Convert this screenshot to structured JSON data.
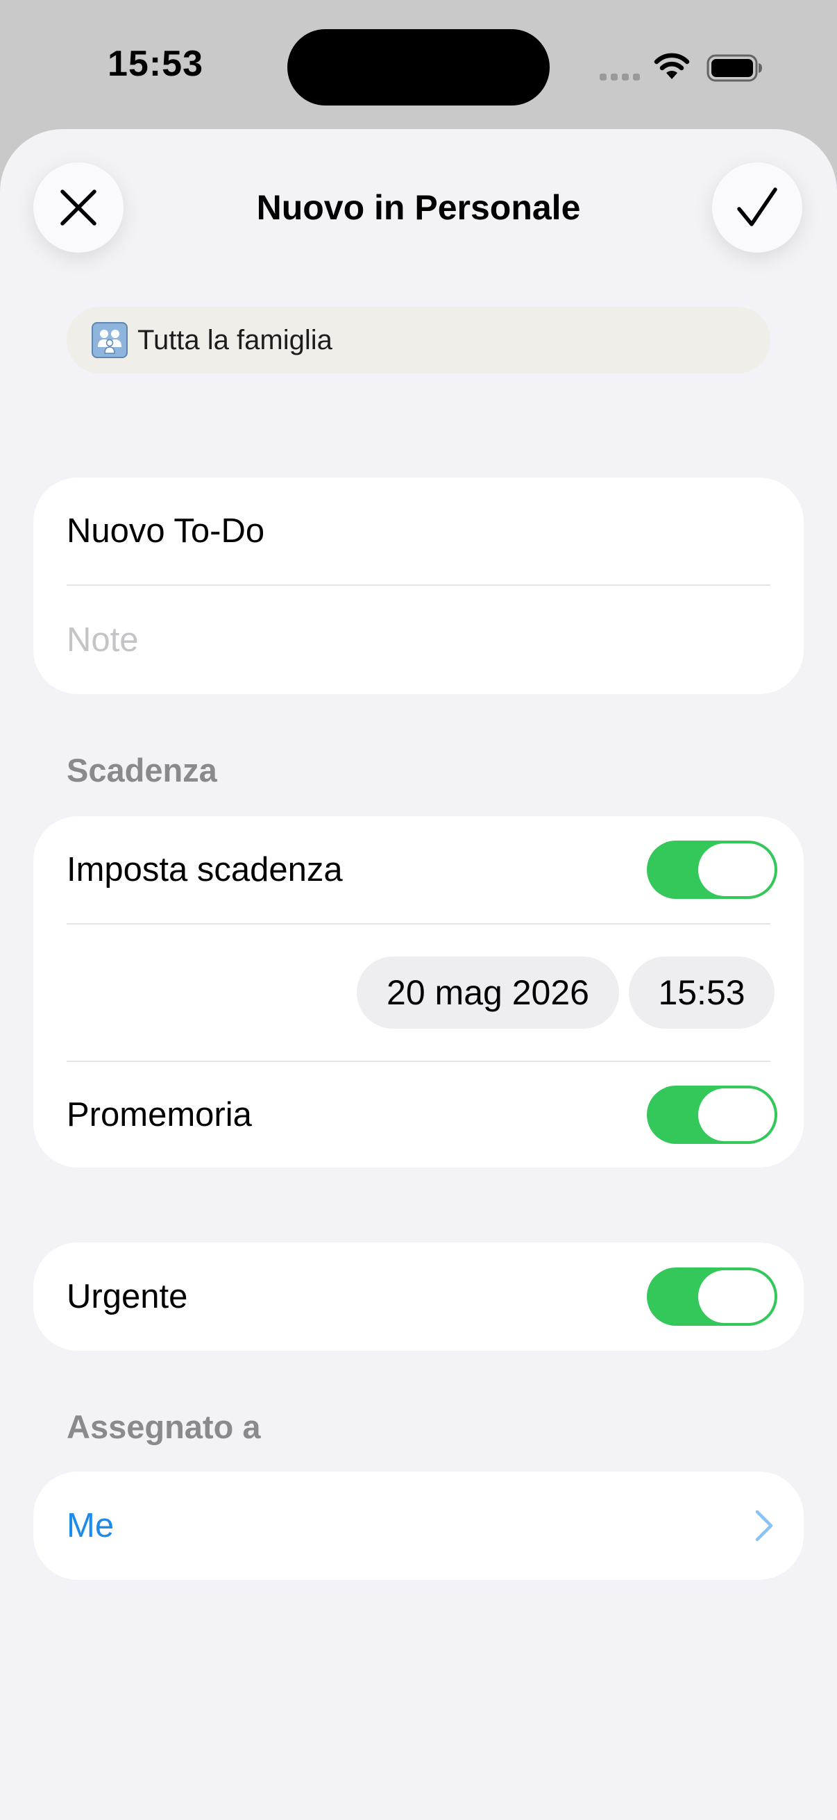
{
  "status_bar": {
    "time": "15:53",
    "wifi_icon": "wifi-icon",
    "battery_icon": "battery-icon"
  },
  "sheet": {
    "title": "Nuovo in Personale",
    "close_icon": "close-icon",
    "done_icon": "checkmark-icon"
  },
  "family_chip": {
    "icon": "family-icon",
    "label": "Tutta la famiglia"
  },
  "todo": {
    "title_value": "Nuovo To-Do",
    "notes_placeholder": "Note"
  },
  "deadline": {
    "header": "Scadenza",
    "set_deadline_label": "Imposta scadenza",
    "set_deadline_on": true,
    "date": "20 mag 2026",
    "time": "15:53",
    "reminder_label": "Promemoria",
    "reminder_on": true
  },
  "urgent": {
    "label": "Urgente",
    "on": true
  },
  "assigned": {
    "header": "Assegnato a",
    "value": "Me",
    "chevron_icon": "chevron-right-icon"
  },
  "colors": {
    "accent_blue": "#1d8bec",
    "toggle_green": "#34c759",
    "background": "#f2f2f7"
  }
}
